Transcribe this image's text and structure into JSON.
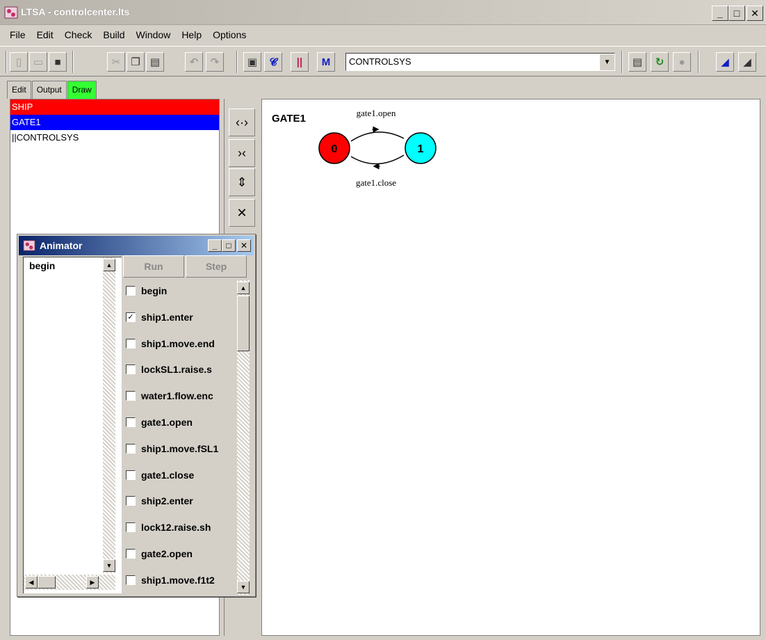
{
  "window": {
    "title": "LTSA - controlcenter.lts",
    "min_glyph": "_",
    "max_glyph": "□",
    "close_glyph": "✕"
  },
  "menu": [
    "File",
    "Edit",
    "Check",
    "Build",
    "Window",
    "Help",
    "Options"
  ],
  "toolbar": {
    "target": "CONTROLSYS"
  },
  "tabs": [
    "Edit",
    "Output",
    "Draw"
  ],
  "processes": [
    "SHIP",
    "GATE1",
    "||CONTROLSYS"
  ],
  "diagram": {
    "process_name": "GATE1",
    "states": [
      {
        "id": "0",
        "color": "#ff0000"
      },
      {
        "id": "1",
        "color": "#00ffff"
      }
    ],
    "transitions": [
      "gate1.open",
      "gate1.close"
    ]
  },
  "animator": {
    "title": "Animator",
    "trace": [
      "begin"
    ],
    "run_label": "Run",
    "step_label": "Step",
    "actions": [
      {
        "label": "begin",
        "checked": false
      },
      {
        "label": "ship1.enter",
        "checked": true
      },
      {
        "label": "ship1.move.end",
        "checked": false
      },
      {
        "label": "lockSL1.raise.s",
        "checked": false
      },
      {
        "label": "water1.flow.enc",
        "checked": false
      },
      {
        "label": "gate1.open",
        "checked": false
      },
      {
        "label": "ship1.move.fSL1",
        "checked": false
      },
      {
        "label": "gate1.close",
        "checked": false
      },
      {
        "label": "ship2.enter",
        "checked": false
      },
      {
        "label": "lock12.raise.sh",
        "checked": false
      },
      {
        "label": "gate2.open",
        "checked": false
      },
      {
        "label": "ship1.move.f1t2",
        "checked": false
      }
    ]
  }
}
